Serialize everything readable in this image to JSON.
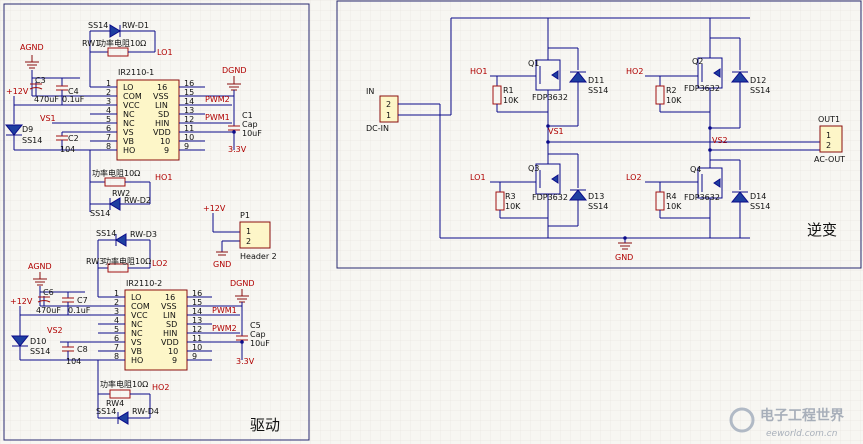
{
  "panels": {
    "driver_label": "驱动",
    "inverter_label": "逆变"
  },
  "driver1": {
    "ic_name": "IR2110-1",
    "pins_left": [
      "LO",
      "COM",
      "VCC",
      "NC",
      "NC",
      "VS",
      "VB",
      "HO"
    ],
    "pins_left_num": [
      "1",
      "2",
      "3",
      "4",
      "5",
      "6",
      "7",
      "8"
    ],
    "pins_right": [
      "16",
      "VSS",
      "LIN",
      "SD",
      "HIN",
      "VDD",
      "10",
      "9"
    ],
    "pins_right_num": [
      "16",
      "15",
      "14",
      "13",
      "12",
      "11",
      "10",
      "9"
    ],
    "agnd": "AGND",
    "dgnd": "DGND",
    "v12": "+12V",
    "v33": "3.3V",
    "c3": "C3",
    "c3_val": "470uF",
    "c4": "C4",
    "c4_val": "0.1uF",
    "c2": "C2",
    "c2_val": "104",
    "c1": "C1",
    "c1_name": "Cap",
    "c1_val": "10uF",
    "d9": "D9",
    "d9_val": "SS14",
    "vs1": "VS1",
    "pwm2": "PWM2",
    "pwm1": "PWM1",
    "d1_val": "SS14",
    "d1": "RW-D1",
    "rw1": "RW1",
    "rw1_val": "功率电阻10Ω",
    "lo1": "LO1",
    "rw2_val": "功率电阻10Ω",
    "rw2": "RW2",
    "ho1": "HO1",
    "d2_val": "SS14",
    "d2": "RW-D2"
  },
  "driver2": {
    "ic_name": "IR2110-2",
    "agnd": "AGND",
    "dgnd": "DGND",
    "v12": "+12V",
    "v33": "3.3V",
    "c6": "C6",
    "c6_val": "470uF",
    "c7": "C7",
    "c7_val": "0.1uF",
    "c8": "C8",
    "c8_val": "104",
    "c5": "C5",
    "c5_name": "Cap",
    "c5_val": "10uF",
    "d10": "D10",
    "d10_val": "SS14",
    "vs2": "VS2",
    "pwm1": "PWM1",
    "pwm2": "PWM2",
    "d3_val": "SS14",
    "d3": "RW-D3",
    "rw3": "RW3",
    "rw3_val": "功率电阻10Ω",
    "lo2": "LO2",
    "rw4_val": "功率电阻10Ω",
    "rw4": "RW4",
    "ho2": "HO2",
    "d4_val": "SS14",
    "d4": "RW-D4"
  },
  "header": {
    "v12": "+12V",
    "p1": "P1",
    "name": "Header 2",
    "gnd": "GND",
    "pin1": "1",
    "pin2": "2"
  },
  "inverter": {
    "in_label": "IN",
    "in_name": "DC-IN",
    "out_label": "OUT1",
    "out_name": "AC-OUT",
    "pin1": "1",
    "pin2": "2",
    "gnd": "GND",
    "vs1": "VS1",
    "vs2": "VS2",
    "q1": "Q1",
    "q2": "Q2",
    "q3": "Q3",
    "q4": "Q4",
    "fdp": "FDP3632",
    "d11": "D11",
    "d12": "D12",
    "d13": "D13",
    "d14": "D14",
    "ss14": "SS14",
    "r1": "R1",
    "r2": "R2",
    "r3": "R3",
    "r4": "R4",
    "r_val": "10K",
    "ho1": "HO1",
    "ho2": "HO2",
    "lo1": "LO1",
    "lo2": "LO2"
  },
  "watermark": {
    "cn": "电子工程世界",
    "en": "eeworld.com.cn"
  }
}
